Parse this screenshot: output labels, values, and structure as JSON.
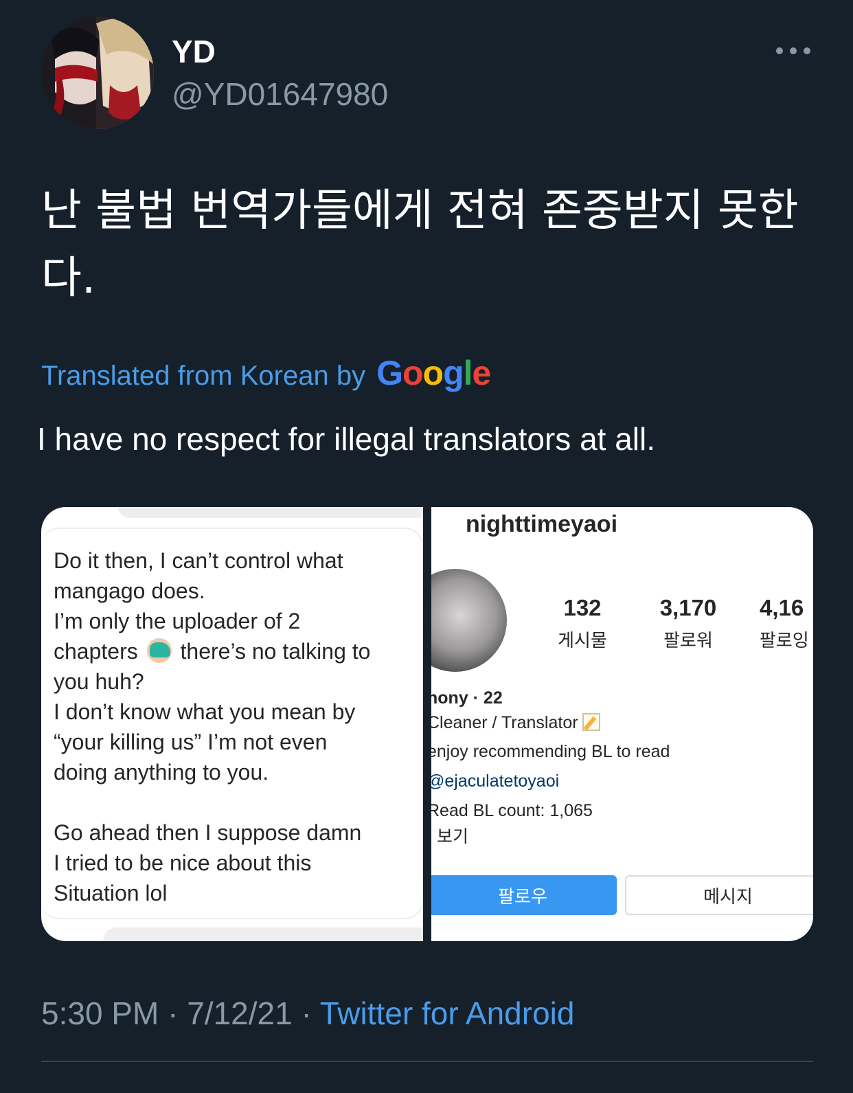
{
  "tweet": {
    "display_name": "YD",
    "handle": "@YD01647980",
    "text": "난 불법 번역가들에게 전혀 존중받지 못한다.",
    "translated_label": "Translated from Korean by",
    "google_letters": [
      "G",
      "o",
      "o",
      "g",
      "l",
      "e"
    ],
    "translation": "I have no respect for illegal translators at all.",
    "time": "5:30 PM",
    "date": "7/12/21",
    "source": "Twitter for Android",
    "separator": "·"
  },
  "media_left": {
    "message_line_1": "Do it then, I can’t control what\nmangago does.\nI’m only the uploader of 2\nchapters ",
    "message_line_2": " there’s no talking to\nyou huh?\nI don’t know what you mean by\n“your killing us” I’m not even\ndoing anything to you.\n\nGo ahead then I suppose damn\nI tried to be nice about this\nSituation lol"
  },
  "media_right": {
    "username": "nighttimeyaoi",
    "stats": [
      {
        "value": "132",
        "label": "게시물"
      },
      {
        "value": "3,170",
        "label": "팔로워"
      },
      {
        "value": "4,16",
        "label": "팔로잉"
      }
    ],
    "bio": {
      "name_line": "hony · 22",
      "role_line": "Cleaner / Translator",
      "desc_line": "enjoy recommending BL to read",
      "link_line": "@ejaculatetoyaoi",
      "count_line": "Read BL count: 1,065",
      "more_line": "보기"
    },
    "follow_label": "팔로우",
    "message_label": "메시지"
  },
  "colors": {
    "background": "#15202b",
    "accent": "#4a9ce8",
    "muted": "#8899a6",
    "instagram_blue": "#3897f0"
  },
  "icons": [
    "more-icon",
    "facepalm-emoji-icon",
    "memo-emoji-icon"
  ]
}
